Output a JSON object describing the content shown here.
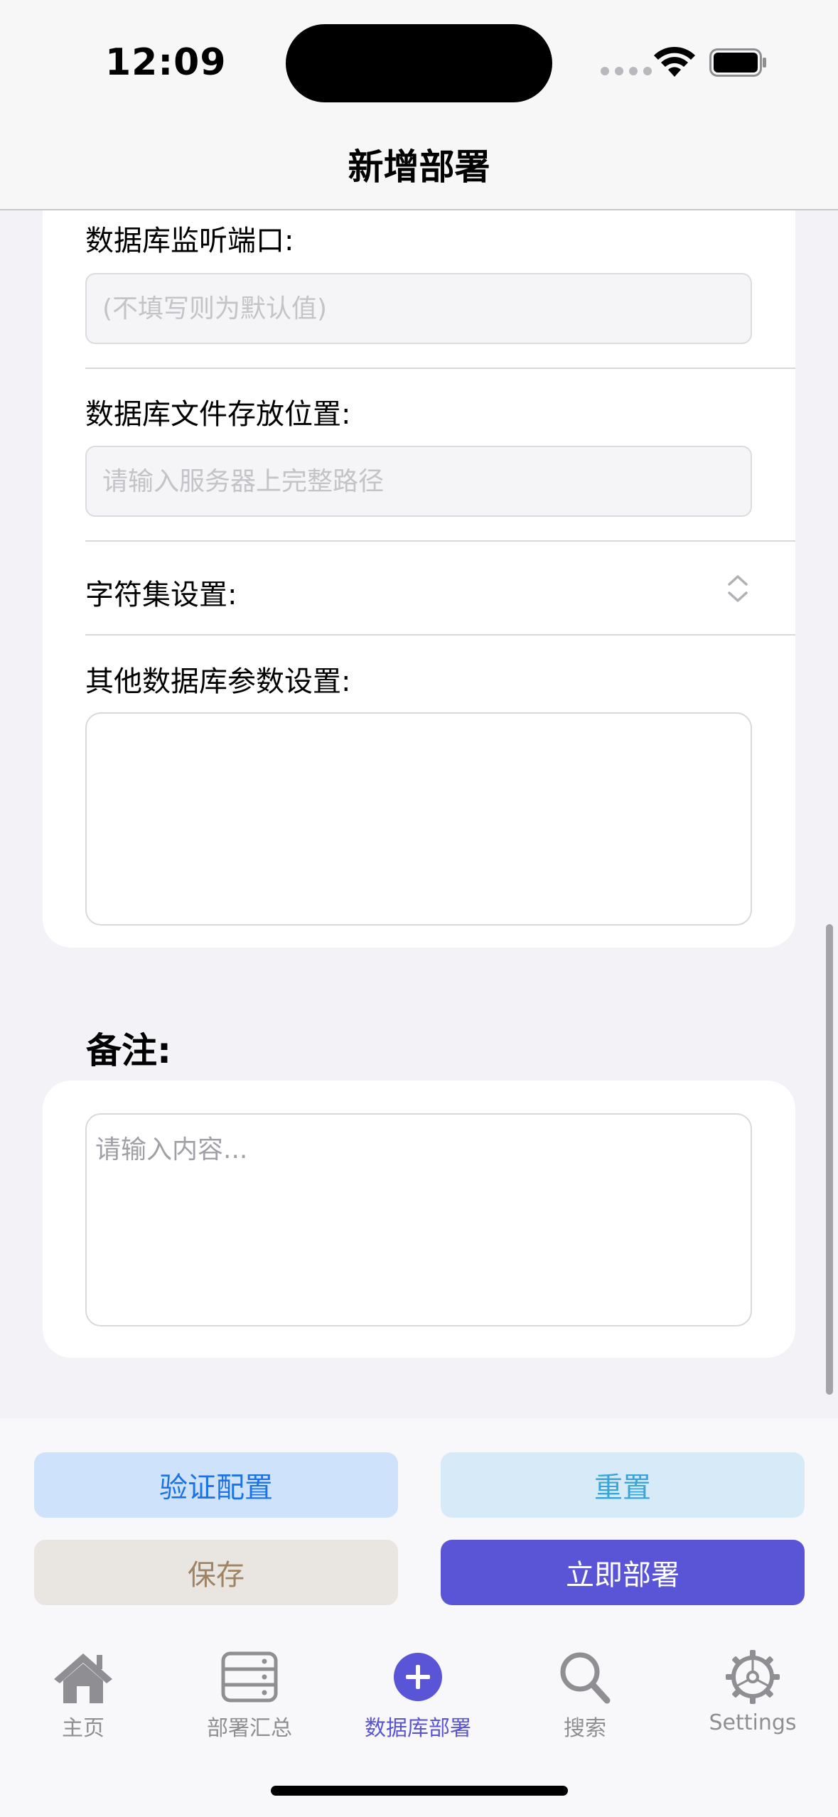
{
  "status_bar": {
    "time": "12:09"
  },
  "nav": {
    "title": "新增部署"
  },
  "form": {
    "port": {
      "label": "数据库监听端口:",
      "placeholder": "(不填写则为默认值)",
      "value": ""
    },
    "path": {
      "label": "数据库文件存放位置:",
      "placeholder": "请输入服务器上完整路径",
      "value": ""
    },
    "charset": {
      "label": "字符集设置:"
    },
    "other": {
      "label": "其他数据库参数设置:",
      "value": ""
    }
  },
  "notes": {
    "title": "备注:",
    "placeholder": "请输入内容..."
  },
  "actions": {
    "verify": "验证配置",
    "reset": "重置",
    "save": "保存",
    "deploy": "立即部署"
  },
  "tabs": [
    {
      "label": "主页",
      "icon": "house-icon"
    },
    {
      "label": "部署汇总",
      "icon": "server-icon"
    },
    {
      "label": "数据库部署",
      "icon": "plus-circle-icon",
      "active": true
    },
    {
      "label": "搜索",
      "icon": "search-icon"
    },
    {
      "label": "Settings",
      "icon": "gear-icon"
    }
  ],
  "colors": {
    "accent": "#5a55d6",
    "inactive": "#8e8e93",
    "background": "#f2f2f7"
  }
}
